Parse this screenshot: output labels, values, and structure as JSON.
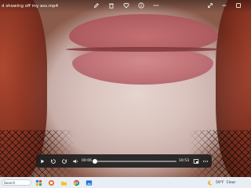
{
  "window": {
    "title": "d showing off my ass.mp4",
    "title_actions": [
      "edit-icon",
      "delete-icon",
      "favorite-icon",
      "info-icon",
      "more-icon"
    ],
    "controls": [
      "expand-icon",
      "minimize-icon",
      "maximize-icon"
    ]
  },
  "player": {
    "time_current": "00:06",
    "time_total": "10:53",
    "progress": 0.01
  },
  "taskbar": {
    "search_placeholder": "Search",
    "weather_temp": "59°F",
    "weather_desc": "Clear",
    "apps": [
      "widgets-icon",
      "task-view-icon",
      "file-explorer-icon",
      "chrome-icon",
      "photos-icon"
    ]
  },
  "colors": {
    "player_bg": "#202020",
    "taskbar_bg": "#e8eef4",
    "accent": "#ffffff"
  }
}
